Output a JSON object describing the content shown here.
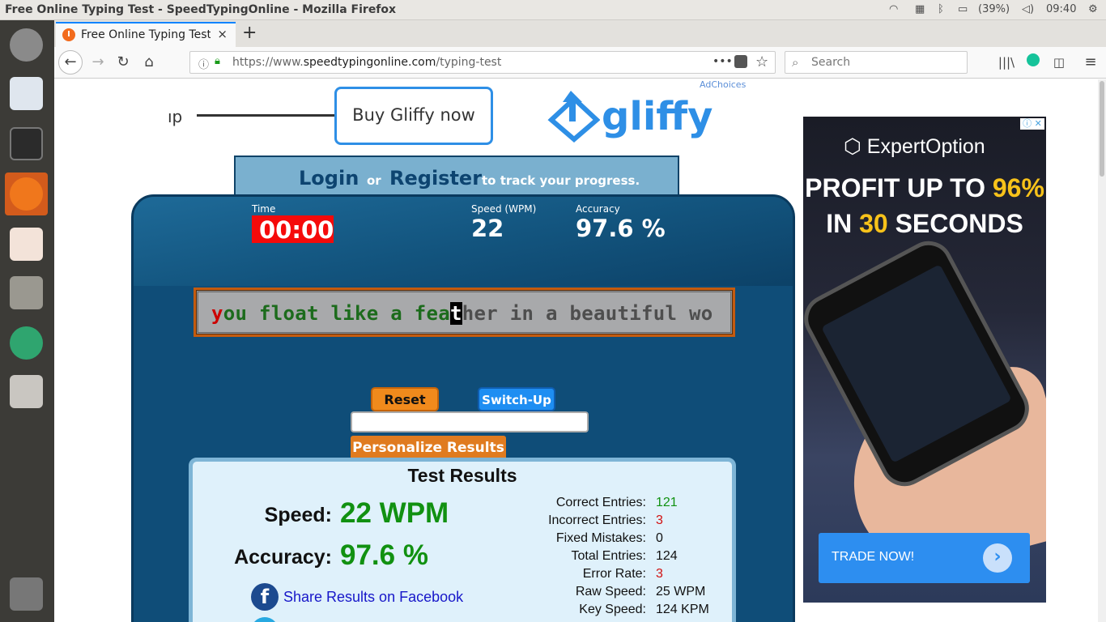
{
  "window": {
    "title": "Free Online Typing Test - SpeedTypingOnline - Mozilla Firefox",
    "battery": "(39%)",
    "clock": "09:40"
  },
  "browser": {
    "tab_title": "Free Online Typing Test - SpeedTypingOnline",
    "tab_close": "×",
    "new_tab": "+",
    "url_prefix": "https://www.",
    "url_domain": "speedtypingonline.com",
    "url_path": "/typing-test",
    "page_actions": "•••",
    "search_placeholder": "Search"
  },
  "ad_top": {
    "adchoices": "AdChoices",
    "partial_text": "ıp",
    "button": "Buy Gliffy now",
    "logo": "gliffy"
  },
  "login_banner": {
    "login": "Login",
    "or": "or",
    "register": "Register",
    "suffix": "to track your progress."
  },
  "stats": {
    "time_label": "Time",
    "time_value": "00:00",
    "speed_label": "Speed (WPM)",
    "speed_value": "22",
    "accuracy_label": "Accuracy",
    "accuracy_value": "97.6 %"
  },
  "typing": {
    "error_char": "y",
    "typed": "ou float like a fea",
    "cursor_char": "t",
    "remaining": "her in a beautiful wo"
  },
  "controls": {
    "reset": "Reset",
    "switch_up": "Switch-Up",
    "personalize": "Personalize Results"
  },
  "results": {
    "heading": "Test Results",
    "speed_label": "Speed:",
    "speed_value": "22 WPM",
    "accuracy_label": "Accuracy:",
    "accuracy_value": "97.6 %",
    "share_facebook": "Share Results on Facebook",
    "details": [
      {
        "label": "Correct Entries:",
        "value": "121",
        "color": "#119111"
      },
      {
        "label": "Incorrect Entries:",
        "value": "3",
        "color": "#d11111"
      },
      {
        "label": "Fixed Mistakes:",
        "value": "0",
        "color": "#111111"
      },
      {
        "label": "Total Entries:",
        "value": "124",
        "color": "#111111"
      },
      {
        "label": "Error Rate:",
        "value": "3",
        "color": "#d11111"
      },
      {
        "label": "Raw Speed:",
        "value": "25 WPM",
        "color": "#111111"
      },
      {
        "label": "Key Speed:",
        "value": "124 KPM",
        "color": "#111111"
      }
    ]
  },
  "ad_right": {
    "brand": "ExpertOption",
    "line1_a": "PROFIT UP TO ",
    "line1_b": "96%",
    "line2_a": "IN ",
    "line2_b": "30",
    "line2_c": " SECONDS",
    "cta": "TRADE NOW!",
    "close": "ⓘ ✕"
  }
}
